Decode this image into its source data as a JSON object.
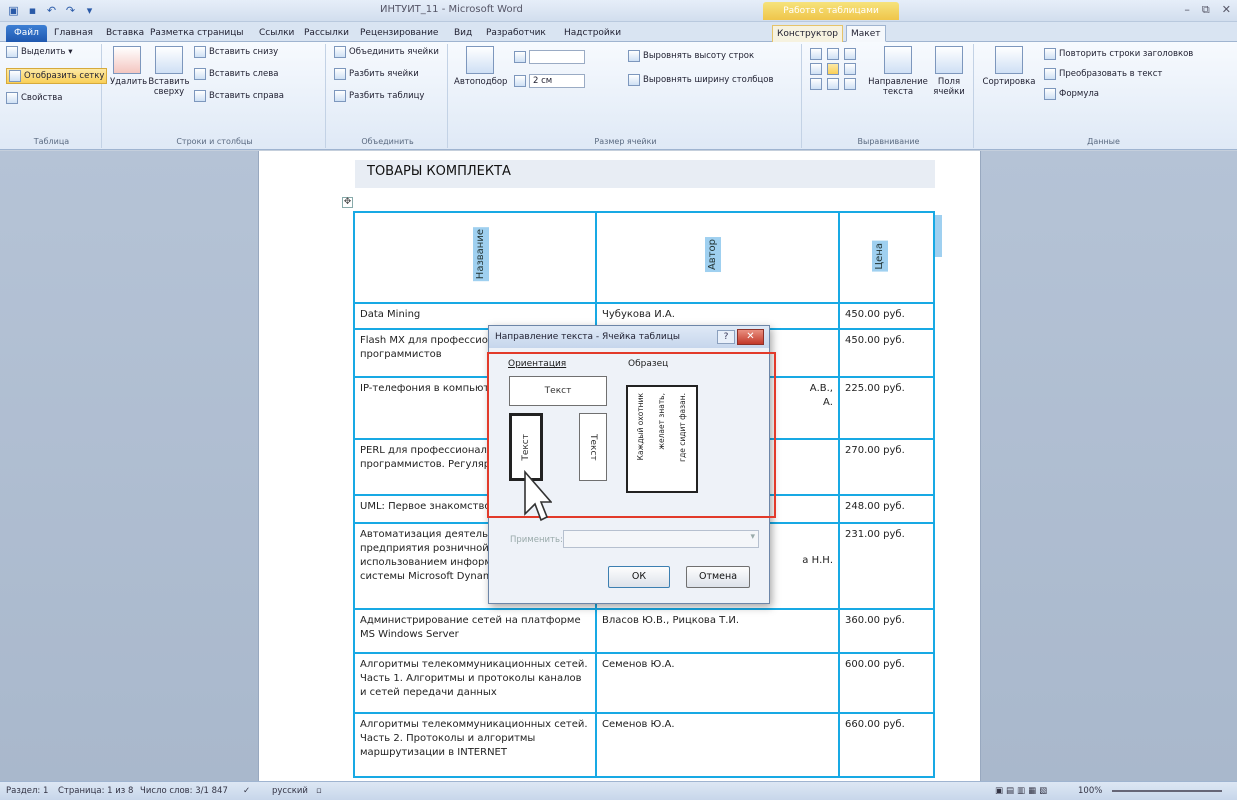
{
  "window": {
    "title": "ИНТУИТ_11 - Microsoft Word",
    "context_tab_group": "Работа с таблицами",
    "controls": [
      "–",
      "⧉",
      "✕"
    ]
  },
  "tabs": [
    {
      "label": "Файл",
      "kind": "file"
    },
    {
      "label": "Главная"
    },
    {
      "label": "Вставка"
    },
    {
      "label": "Разметка страницы"
    },
    {
      "label": "Ссылки"
    },
    {
      "label": "Рассылки"
    },
    {
      "label": "Рецензирование"
    },
    {
      "label": "Вид"
    },
    {
      "label": "Разработчик"
    },
    {
      "label": "Надстройки"
    },
    {
      "label": "Конструктор",
      "kind": "ctx"
    },
    {
      "label": "Макет",
      "kind": "active"
    }
  ],
  "ribbon": {
    "table": {
      "label": "Таблица",
      "select": "Выделить ▾",
      "gridlines": "Отобразить сетку",
      "properties": "Свойства"
    },
    "rows_cols": {
      "label": "Строки и столбцы",
      "delete": "Удалить",
      "insert_above": "Вставить сверху",
      "insert_below": "Вставить снизу",
      "insert_left": "Вставить слева",
      "insert_right": "Вставить справа"
    },
    "merge": {
      "label": "Объединить",
      "merge_cells": "Объединить ячейки",
      "split_cells": "Разбить ячейки",
      "split_table": "Разбить таблицу"
    },
    "cell_size": {
      "label": "Размер ячейки",
      "autofit": "Автоподбор",
      "width_value": "2 см",
      "distribute_rows": "Выровнять высоту строк",
      "distribute_cols": "Выровнять ширину столбцов"
    },
    "alignment": {
      "label": "Выравнивание",
      "text_direction": "Направление текста",
      "cell_margins": "Поля ячейки"
    },
    "data": {
      "label": "Данные",
      "sort": "Сортировка",
      "repeat_header": "Повторить строки заголовков",
      "convert": "Преобразовать в текст",
      "formula": "Формула"
    }
  },
  "document": {
    "heading": "ТОВАРЫ КОМПЛЕКТА",
    "headers": [
      "Название",
      "Автор",
      "Цена"
    ],
    "rows": [
      {
        "title": "Data Mining",
        "author": "Чубукова И.А.",
        "price": "450.00 руб."
      },
      {
        "title": "Flash MX для профессиональных программистов",
        "author": "",
        "price": "450.00 руб."
      },
      {
        "title": "IP-телефония в компьютерных сетях",
        "author": "А.В.,",
        "author2": "А.",
        "price": "225.00 руб."
      },
      {
        "title": "PERL для профессиональных программистов. Регулярные выражения",
        "author": "",
        "price": "270.00 руб."
      },
      {
        "title": "UML: Первое знакомство",
        "author": "",
        "price": "248.00 руб."
      },
      {
        "title": "Автоматизация деятельности предприятия розничной торговли с использованием информационной системы Microsoft Dynamics",
        "author": "а Н.Н.",
        "price": "231.00 руб."
      },
      {
        "title": "Администрирование сетей на платформе MS Windows Server",
        "author": "Власов Ю.В., Рицкова Т.И.",
        "price": "360.00 руб."
      },
      {
        "title": "Алгоритмы телекоммуникационных сетей. Часть 1. Алгоритмы и протоколы каналов и сетей передачи данных",
        "author": "Семенов Ю.А.",
        "price": "600.00 руб."
      },
      {
        "title": "Алгоритмы телекоммуникационных сетей. Часть 2. Протоколы и алгоритмы маршрутизации в INTERNET",
        "author": "Семенов Ю.А.",
        "price": "660.00 руб."
      }
    ]
  },
  "dialog": {
    "title": "Направление текста - Ячейка таблицы",
    "help": "?",
    "close": "✕",
    "orientation_label": "Ориентация",
    "sample_label": "Образец",
    "option_text": "Текст",
    "sample_lines": [
      "Каждый охотник",
      "желает знать,",
      "где сидит фазан."
    ],
    "apply_label": "Применить:",
    "ok": "ОК",
    "cancel": "Отмена"
  },
  "status": {
    "page": "Раздел: 1",
    "pages": "Страница: 1 из 8",
    "words": "Число слов: 3/1 847",
    "language": "русский",
    "zoom": "100%"
  },
  "colors": {
    "table_border": "#18a9e4",
    "highlight": "#9fd0f0",
    "red_outline": "#e23a2a",
    "ribbon_accent": "#f9cf58"
  }
}
